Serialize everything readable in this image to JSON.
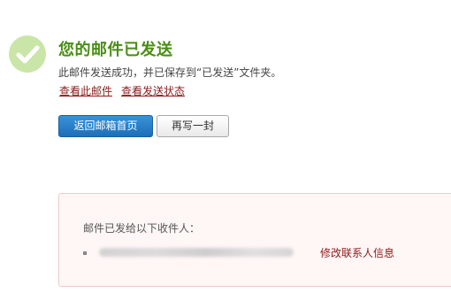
{
  "status": {
    "title": "您的邮件已发送",
    "description": "此邮件发送成功，并已保存到“已发送”文件夹。",
    "icon": "checkmark-circle-icon"
  },
  "links": {
    "view_mail": "查看此邮件",
    "view_status": "查看发送状态"
  },
  "buttons": {
    "back_to_inbox": "返回邮箱首页",
    "write_another": "再写一封"
  },
  "recipients": {
    "heading": "邮件已发给以下收件人：",
    "items": [
      {
        "edit_label": "修改联系人信息"
      }
    ]
  },
  "colors": {
    "success_green": "#4a8d16",
    "link_red": "#8b1a1a",
    "primary_blue": "#1c6fb8",
    "panel_bg": "#fff6f6",
    "panel_border": "#f0c8cc"
  }
}
